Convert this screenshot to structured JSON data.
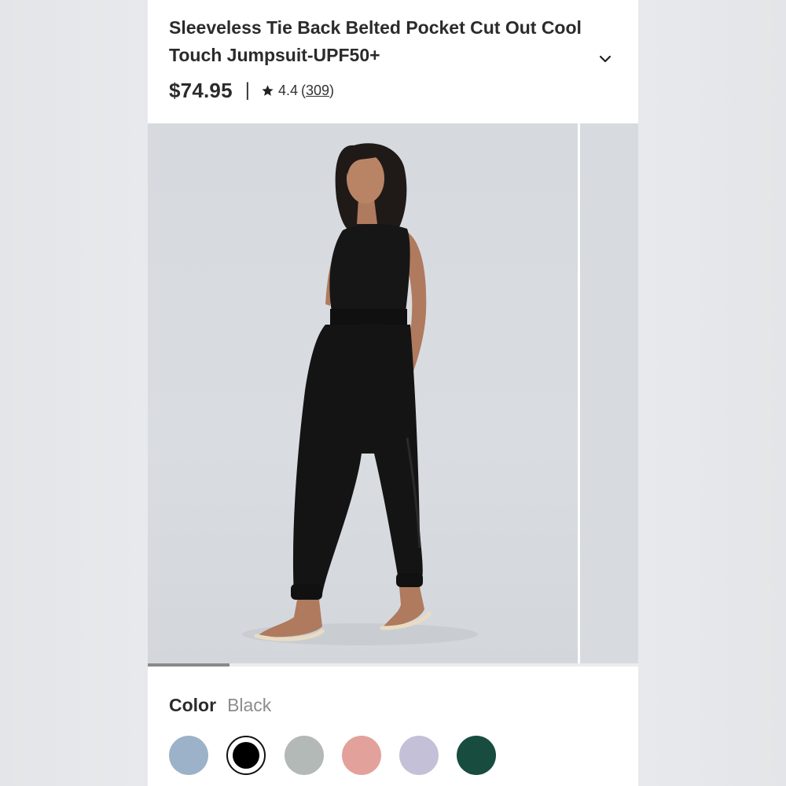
{
  "product": {
    "title": "Sleeveless Tie Back Belted Pocket Cut Out Cool Touch Jumpsuit-UPF50+",
    "price": "$74.95",
    "separator": "|",
    "rating": "4.4",
    "review_count_open": "(",
    "review_count": "309",
    "review_count_close": ")"
  },
  "icons": {
    "expand": "chevron-down-icon",
    "rating": "star-icon"
  },
  "gallery": {
    "image_alt": "Model wearing black sleeveless belted jumpsuit",
    "progress_fraction": 0.167
  },
  "color": {
    "label": "Color",
    "selected": "Black",
    "swatches": [
      {
        "name": "Light Blue",
        "hex": "#9cb2c9"
      },
      {
        "name": "Black",
        "hex": "#000000"
      },
      {
        "name": "Gray",
        "hex": "#b3b9b7"
      },
      {
        "name": "Pink",
        "hex": "#e3a19c"
      },
      {
        "name": "Lavender",
        "hex": "#c4c0d8"
      },
      {
        "name": "Green",
        "hex": "#174c3e"
      }
    ]
  }
}
